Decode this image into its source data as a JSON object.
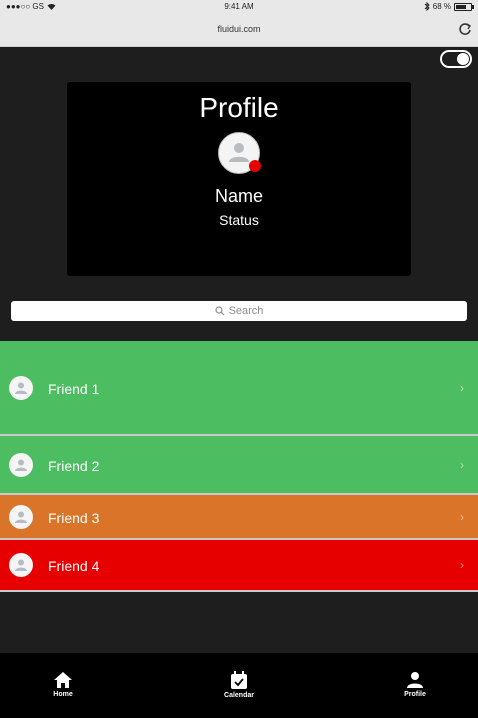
{
  "status_bar": {
    "carrier": "●●●○○ GS",
    "time": "9:41 AM",
    "battery": "68 %",
    "battery_level": 0.68
  },
  "browser": {
    "url": "fluidui.com"
  },
  "toggle": {
    "state": "on"
  },
  "profile": {
    "title": "Profile",
    "name": "Name",
    "status": "Status",
    "status_color": "#e60000"
  },
  "search": {
    "placeholder": "Search"
  },
  "friends": [
    {
      "label": "Friend 1",
      "color": "#4cbd60"
    },
    {
      "label": "Friend 2",
      "color": "#4cbd60"
    },
    {
      "label": "Friend 3",
      "color": "#da7429"
    },
    {
      "label": "Friend 4",
      "color": "#e60000"
    }
  ],
  "tabs": [
    {
      "label": "Home",
      "icon": "home-icon"
    },
    {
      "label": "Calendar",
      "icon": "calendar-icon"
    },
    {
      "label": "Profile",
      "icon": "person-icon"
    }
  ],
  "colors": {
    "background": "#1e1e1e",
    "card": "#000000",
    "tabbar": "#000000"
  }
}
